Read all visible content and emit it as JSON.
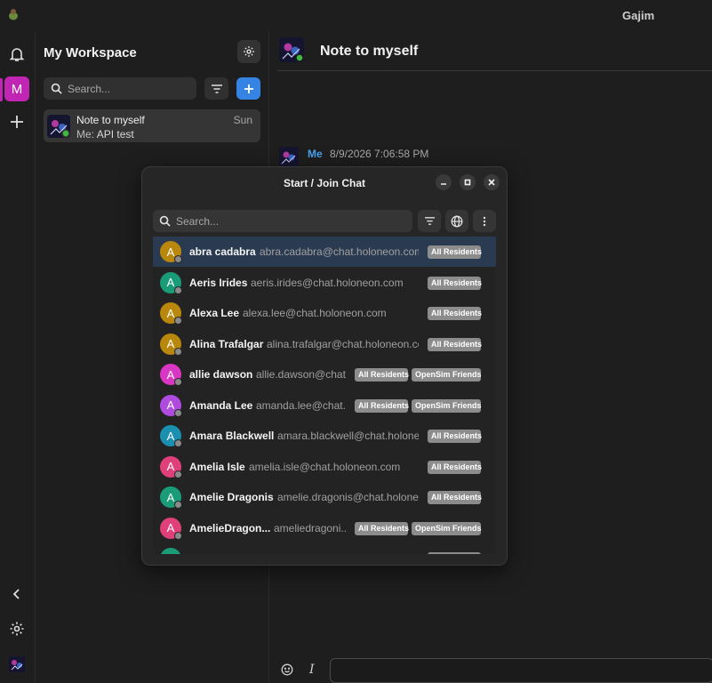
{
  "app": {
    "title": "Gajim"
  },
  "rail": {
    "workspace_letter": "M"
  },
  "sidebar": {
    "workspace_title": "My Workspace",
    "search_placeholder": "Search...",
    "chats": [
      {
        "name": "Note to myself",
        "time": "Sun",
        "preview_prefix": "Me:",
        "preview_text": "API test"
      }
    ]
  },
  "main": {
    "title": "Note to myself",
    "message": {
      "author": "Me",
      "timestamp": "8/9/2026 7:06:58 PM"
    }
  },
  "dialog": {
    "title": "Start / Join Chat",
    "search_placeholder": "Search...",
    "contacts": [
      {
        "name": "abra cadabra",
        "jid": "abra.cadabra@chat.holoneon.com",
        "initial": "A",
        "color": "#b8870b",
        "tags": [
          "All Residents"
        ],
        "selected": true
      },
      {
        "name": "Aeris Irides",
        "jid": "aeris.irides@chat.holoneon.com",
        "initial": "A",
        "color": "#1a9c79",
        "tags": [
          "All Residents"
        ]
      },
      {
        "name": "Alexa Lee",
        "jid": "alexa.lee@chat.holoneon.com",
        "initial": "A",
        "color": "#b8870b",
        "tags": [
          "All Residents"
        ]
      },
      {
        "name": "Alina Trafalgar",
        "jid": "alina.trafalgar@chat.holoneon.com",
        "initial": "A",
        "color": "#b8870b",
        "tags": [
          "All Residents"
        ]
      },
      {
        "name": "allie dawson",
        "jid": "allie.dawson@chat...",
        "initial": "A",
        "color": "#d936c4",
        "tags": [
          "All Residents",
          "OpenSim Friends"
        ]
      },
      {
        "name": "Amanda Lee",
        "jid": "amanda.lee@chat.h...",
        "initial": "A",
        "color": "#b04be0",
        "tags": [
          "All Residents",
          "OpenSim Friends"
        ]
      },
      {
        "name": "Amara Blackwell",
        "jid": "amara.blackwell@chat.holoneo...",
        "initial": "A",
        "color": "#1b8fb0",
        "tags": [
          "All Residents"
        ]
      },
      {
        "name": "Amelia Isle",
        "jid": "amelia.isle@chat.holoneon.com",
        "initial": "A",
        "color": "#e0407a",
        "tags": [
          "All Residents"
        ]
      },
      {
        "name": "Amelie Dragonis",
        "jid": "amelie.dragonis@chat.holoneo...",
        "initial": "A",
        "color": "#1a9c79",
        "tags": [
          "All Residents"
        ]
      },
      {
        "name": "AmelieDragon...",
        "jid": "ameliedragoni...",
        "initial": "A",
        "color": "#e0407a",
        "tags": [
          "All Residents",
          "OpenSim Friends"
        ]
      },
      {
        "name": "",
        "jid": "",
        "initial": "",
        "color": "#1a9c79",
        "tags": [
          ""
        ]
      }
    ]
  },
  "colors": {
    "accent_blue": "#3584e4",
    "workspace": "#c026b3",
    "author": "#4ba3f0",
    "online": "#3fb93f"
  }
}
